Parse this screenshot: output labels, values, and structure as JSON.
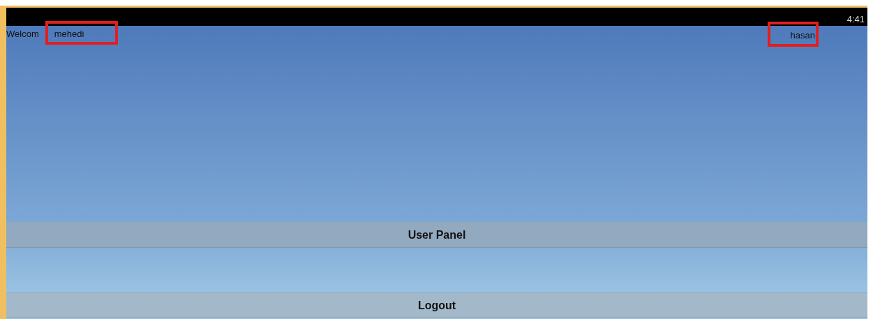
{
  "status_bar": {
    "time": "4:41"
  },
  "header": {
    "welcome": "Welcom",
    "first_name": "mehedi",
    "last_name": "hasan"
  },
  "buttons": [
    {
      "label": "User Panel"
    },
    {
      "label": "Logout"
    }
  ]
}
